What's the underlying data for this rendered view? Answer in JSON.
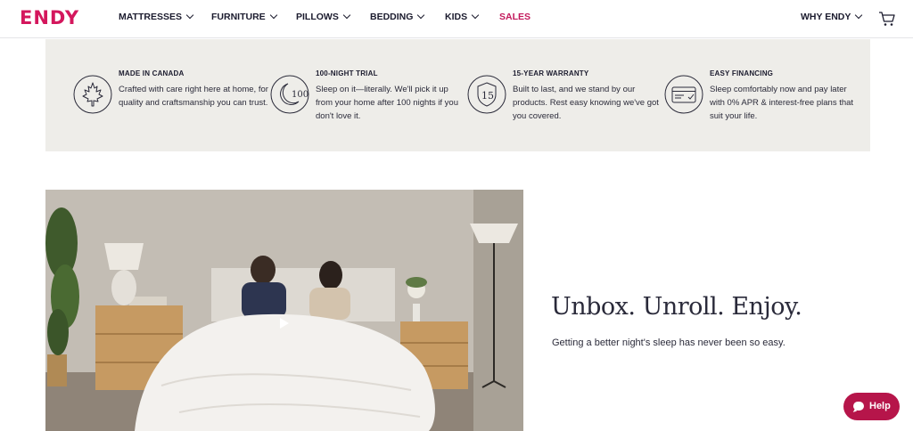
{
  "brand": {
    "logo_text": "ENDY",
    "color": "#d4175d"
  },
  "nav": {
    "items": [
      {
        "label": "MATTRESSES",
        "dropdown": true
      },
      {
        "label": "FURNITURE",
        "dropdown": true
      },
      {
        "label": "PILLOWS",
        "dropdown": true
      },
      {
        "label": "BEDDING",
        "dropdown": true
      },
      {
        "label": "KIDS",
        "dropdown": true
      },
      {
        "label": "SALES",
        "dropdown": false,
        "color": "#c2185b"
      }
    ],
    "right_item": {
      "label": "WHY ENDY",
      "dropdown": true
    },
    "cart_icon": "cart-icon"
  },
  "features": [
    {
      "icon": "maple-leaf-icon",
      "title": "MADE IN CANADA",
      "desc": "Crafted with care right here at home, for quality and craftsmanship you can trust."
    },
    {
      "icon": "moon-100-icon",
      "icon_text": "100",
      "title": "100-NIGHT TRIAL",
      "desc": "Sleep on it—literally. We'll pick it up from your home after 100 nights if you don't love it."
    },
    {
      "icon": "shield-15-icon",
      "icon_text": "15",
      "title": "15-YEAR WARRANTY",
      "desc": "Built to last, and we stand by our products. Rest easy knowing we've got you covered."
    },
    {
      "icon": "credit-card-icon",
      "title": "EASY FINANCING",
      "desc": "Sleep comfortably now and pay later with 0% APR & interest-free plans that suit your life."
    }
  ],
  "hero": {
    "headline": "Unbox. Unroll. Enjoy.",
    "subline": "Getting a better night's sleep has never been so easy.",
    "video_play_icon": "play-icon"
  },
  "help_button": {
    "label": "Help",
    "color": "#b6154a"
  }
}
